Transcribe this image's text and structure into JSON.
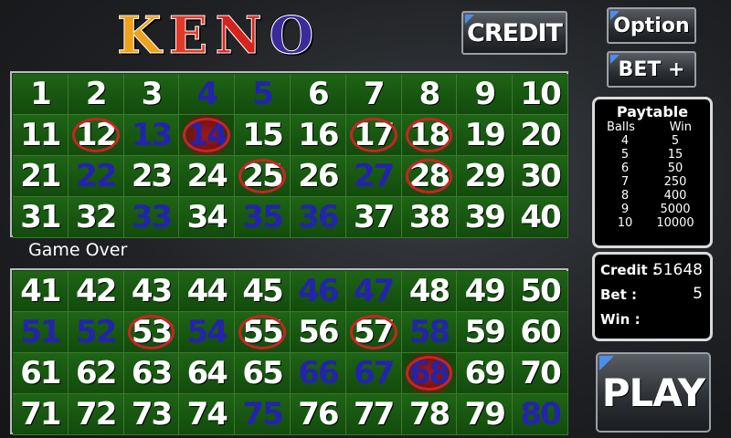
{
  "logo": [
    {
      "letter": "K",
      "color": "#f0a21c"
    },
    {
      "letter": "E",
      "color": "#e23a2a"
    },
    {
      "letter": "N",
      "color": "#d6241c"
    },
    {
      "letter": "O",
      "color": "#3a2a9c"
    }
  ],
  "buttons": {
    "credit": "CREDIT",
    "option": "Option",
    "bet": "BET +",
    "play": "PLAY"
  },
  "status": "Game Over",
  "paytable": {
    "title": "Paytable",
    "col_balls": "Balls",
    "col_win": "Win",
    "rows": [
      {
        "balls": "4",
        "win": "5"
      },
      {
        "balls": "5",
        "win": "15"
      },
      {
        "balls": "6",
        "win": "50"
      },
      {
        "balls": "7",
        "win": "250"
      },
      {
        "balls": "8",
        "win": "400"
      },
      {
        "balls": "9",
        "win": "5000"
      },
      {
        "balls": "10",
        "win": "10000"
      }
    ]
  },
  "info": {
    "credit_label": "Credit :",
    "credit_value": "51648",
    "bet_label": "Bet :",
    "bet_value": "5",
    "win_label": "Win :",
    "win_value": ""
  },
  "numbers": {
    "drawn": [
      4,
      5,
      13,
      14,
      22,
      27,
      33,
      35,
      36,
      46,
      47,
      51,
      52,
      54,
      58,
      66,
      67,
      68,
      75,
      80
    ],
    "picked": [
      12,
      14,
      17,
      18,
      25,
      28,
      53,
      55,
      57,
      68
    ]
  },
  "colors": {
    "drawn": "#2323ad",
    "pick_ring": "#c82424",
    "board": "#124b0c"
  }
}
